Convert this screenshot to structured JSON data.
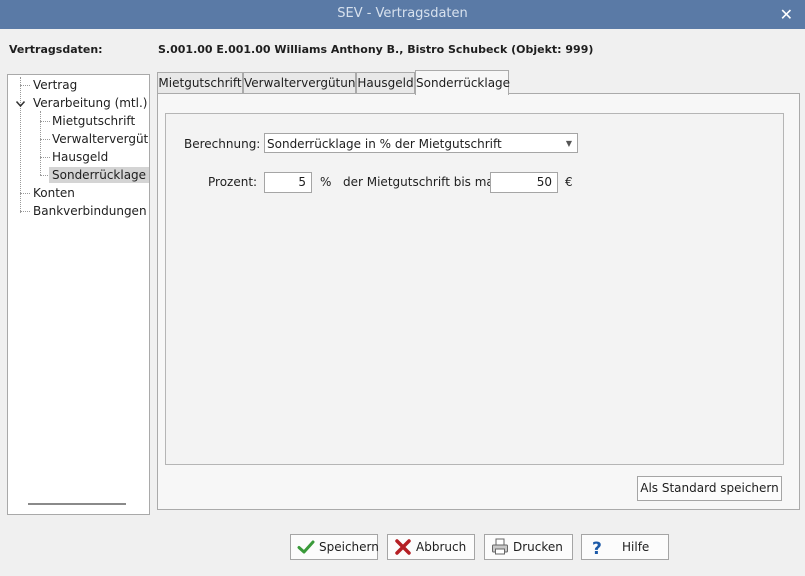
{
  "window": {
    "title": "SEV - Vertragsdaten",
    "close_glyph": "✕"
  },
  "label_vertragsdaten": "Vertragsdaten:",
  "header_text": "S.001.00 E.001.00 Williams Anthony B., Bistro Schubeck (Objekt: 999)",
  "tree": {
    "items": [
      {
        "label": "Vertrag"
      },
      {
        "label": "Verarbeitung (mtl.)"
      },
      {
        "label": "Mietgutschrift"
      },
      {
        "label": "Verwaltervergütun"
      },
      {
        "label": "Hausgeld"
      },
      {
        "label": "Sonderrücklage"
      },
      {
        "label": "Konten"
      },
      {
        "label": "Bankverbindungen"
      }
    ],
    "selected": "Sonderrücklage",
    "expand_icon": "chevron-down-icon"
  },
  "tabs": [
    {
      "label": "Mietgutschrift"
    },
    {
      "label": "Verwaltervergütung"
    },
    {
      "label": "Hausgeld"
    },
    {
      "label": "Sonderrücklage"
    }
  ],
  "active_tab": "Sonderrücklage",
  "form": {
    "berechnung_label": "Berechnung:",
    "berechnung_value": "Sonderrücklage in % der Mietgutschrift",
    "prozent_label": "Prozent:",
    "prozent_value": "5",
    "percent_unit": "%",
    "mid_label": "der Mietgutschrift bis max.",
    "max_value": "50",
    "currency_unit": "€"
  },
  "standard_button": "Als Standard speichern",
  "buttons": {
    "speichern": "Speichern",
    "abbruch": "Abbruch",
    "drucken": "Drucken",
    "hilfe": "Hilfe"
  },
  "colors": {
    "titlebar": "#5a7aa6",
    "check_green": "#3a9a3a",
    "cross_red": "#b51f24",
    "help_blue": "#1c5aa8"
  }
}
